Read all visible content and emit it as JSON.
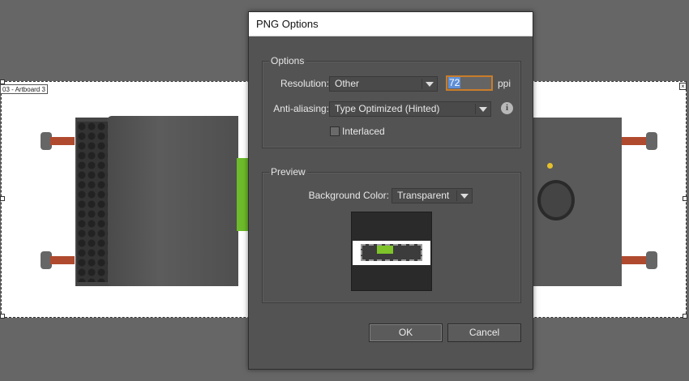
{
  "artboard": {
    "label": "03 - Artboard 3"
  },
  "dialog": {
    "title": "PNG Options",
    "options": {
      "group_title": "Options",
      "resolution_label": "Resolution:",
      "resolution_value": "Other",
      "ppi_value": "72",
      "ppi_unit": "ppi",
      "antialiasing_label": "Anti-aliasing:",
      "antialiasing_value": "Type Optimized (Hinted)",
      "interlaced_label": "Interlaced",
      "interlaced_checked": false
    },
    "preview": {
      "group_title": "Preview",
      "bg_color_label": "Background Color:",
      "bg_color_value": "Transparent"
    },
    "ok_label": "OK",
    "cancel_label": "Cancel"
  },
  "colors": {
    "accent_focus": "#c97d2a",
    "selection": "#5f8fd6",
    "dialog_bg": "#535353"
  }
}
